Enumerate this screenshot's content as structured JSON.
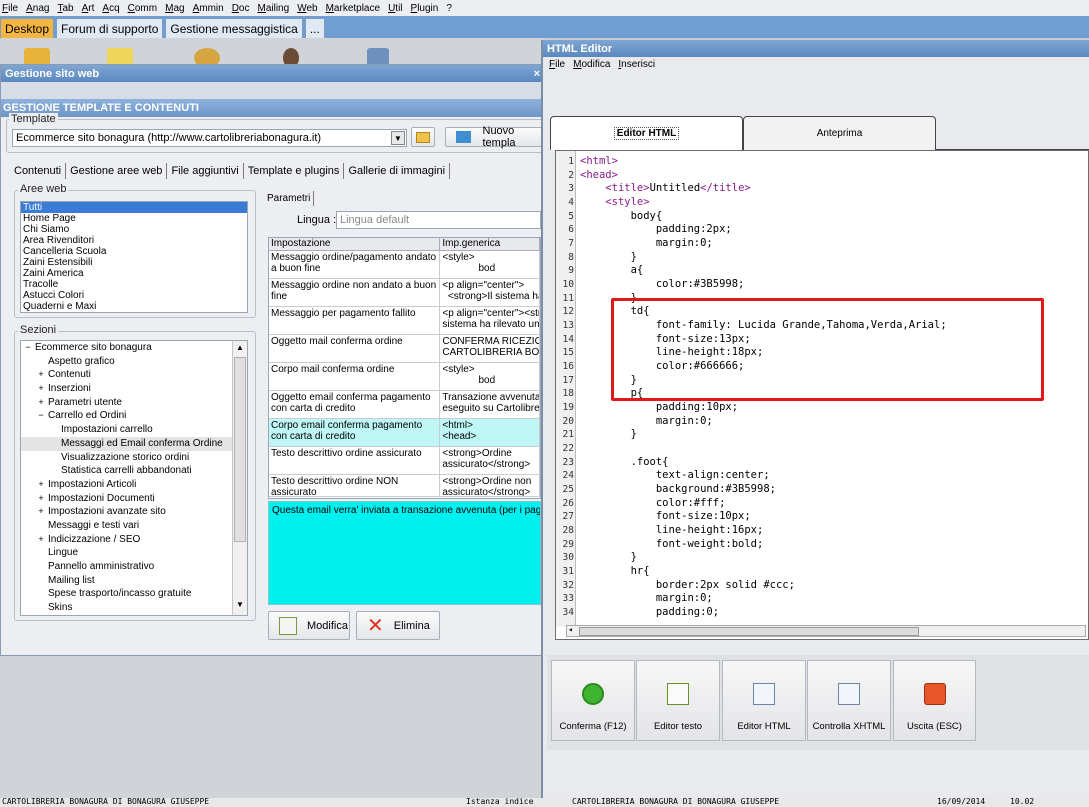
{
  "app_menu": [
    "File",
    "Anag",
    "Tab",
    "Art",
    "Acq",
    "Comm",
    "Mag",
    "Ammin",
    "Doc",
    "Mailing",
    "Web",
    "Marketplace",
    "Util",
    "Plugin",
    "?"
  ],
  "desktop_tabs": [
    "Desktop",
    "Forum di supporto",
    "Gestione messaggistica",
    "..."
  ],
  "win1": {
    "title": "Gestione sito web",
    "close": "×",
    "header": "GESTIONE TEMPLATE E CONTENUTI",
    "template_label": "Template",
    "template_value": "Ecommerce sito bonagura (http://www.cartolibreriabonagura.it)",
    "new_template_label": "Nuovo templa",
    "tabs": [
      "Contenuti",
      "Gestione aree web",
      "File aggiuntivi",
      "Template e plugins",
      "Gallerie di immagini"
    ],
    "aree_label": "Aree web",
    "aree": [
      "Tutti",
      "Home Page",
      "Chi Siamo",
      "Area Rivenditori",
      "Cancelleria Scuola",
      "Zaini Estensibili",
      "Zaini America",
      "Tracolle",
      "Astucci Colori",
      "Quaderni e Maxi"
    ],
    "sezioni_label": "Sezioni",
    "sezioni": [
      {
        "label": "Ecommerce sito bonagura",
        "indent": 0,
        "pm": "−"
      },
      {
        "label": "Aspetto grafico",
        "indent": 1,
        "pm": ""
      },
      {
        "label": "Contenuti",
        "indent": 1,
        "pm": "+"
      },
      {
        "label": "Inserzioni",
        "indent": 1,
        "pm": "+"
      },
      {
        "label": "Parametri utente",
        "indent": 1,
        "pm": "+"
      },
      {
        "label": "Carrello ed Ordini",
        "indent": 1,
        "pm": "−"
      },
      {
        "label": "Impostazioni carrello",
        "indent": 2,
        "pm": ""
      },
      {
        "label": "Messaggi ed Email conferma Ordine",
        "indent": 2,
        "pm": ""
      },
      {
        "label": "Visualizzazione storico ordini",
        "indent": 2,
        "pm": ""
      },
      {
        "label": "Statistica carrelli abbandonati",
        "indent": 2,
        "pm": ""
      },
      {
        "label": "Impostazioni Articoli",
        "indent": 1,
        "pm": "+"
      },
      {
        "label": "Impostazioni Documenti",
        "indent": 1,
        "pm": "+"
      },
      {
        "label": "Impostazioni avanzate sito",
        "indent": 1,
        "pm": "+"
      },
      {
        "label": "Messaggi e testi vari",
        "indent": 1,
        "pm": ""
      },
      {
        "label": "Indicizzazione / SEO",
        "indent": 1,
        "pm": "+"
      },
      {
        "label": "Lingue",
        "indent": 1,
        "pm": ""
      },
      {
        "label": "Pannello amministrativo",
        "indent": 1,
        "pm": ""
      },
      {
        "label": "Mailing list",
        "indent": 1,
        "pm": ""
      },
      {
        "label": "Spese trasporto/incasso gratuite",
        "indent": 1,
        "pm": ""
      },
      {
        "label": "Skins",
        "indent": 1,
        "pm": ""
      }
    ],
    "parametri_tab": "Parametri",
    "lingua_label": "Lingua :",
    "lingua_value": "Lingua default",
    "grid_headers": [
      "Impostazione",
      "Imp.generica"
    ],
    "grid_rows": [
      {
        "a": "Messaggio ordine/pagamento andato a buon fine",
        "b": "<style>\n             bod",
        "h": 28
      },
      {
        "a": "Messaggio ordine non andato a buon fine",
        "b": "<p align=\"center\">\n  <strong>Il sistema ha",
        "h": 28
      },
      {
        "a": "Messaggio per pagamento fallito",
        "b": "<p align=\"center\"><str\nsistema ha rilevato un p",
        "h": 28
      },
      {
        "a": "Oggetto mail conferma ordine",
        "b": "CONFERMA RICEZIONE\nCARTOLIBRERIA BONAG",
        "h": 28
      },
      {
        "a": "Corpo mail conferma ordine",
        "b": "<style>\n             bod",
        "h": 28
      },
      {
        "a": "Oggetto email conferma pagamento con carta di credito",
        "b": "Transazione avvenuta p\neseguito su Cartolibreria",
        "h": 28
      },
      {
        "a": "Corpo email conferma pagamento con carta di credito",
        "b": "<html>\n<head>",
        "h": 28,
        "cyan": true
      },
      {
        "a": "Testo descrittivo ordine assicurato",
        "b": "<strong>Ordine\nassicurato</strong>",
        "h": 28
      },
      {
        "a": "Testo descrittivo ordine NON assicurato",
        "b": "<strong>Ordine non\nassicurato</strong>",
        "h": 22
      }
    ],
    "description": "Questa email verra' inviata a transazione avvenuta (per i pagamen",
    "modifica_label": "Modifica",
    "elimina_label": "Elimina"
  },
  "editor": {
    "title": "HTML Editor",
    "menu": [
      "File",
      "Modifica",
      "Inserisci"
    ],
    "tab_html": "Editor HTML",
    "tab_preview": "Anteprima",
    "lines": [
      "<html>",
      "<head>",
      "    <title>Untitled</title>",
      "    <style>",
      "        body{",
      "            padding:2px;",
      "            margin:0;",
      "        }",
      "        a{",
      "            color:#3B5998;",
      "        }",
      "        td{",
      "            font-family: Lucida Grande,Tahoma,Verda,Arial;",
      "            font-size:13px;",
      "            line-height:18px;",
      "            color:#666666;",
      "        }",
      "        p{",
      "            padding:10px;",
      "            margin:0;",
      "        }",
      "",
      "        .foot{",
      "            text-align:center;",
      "            background:#3B5998;",
      "            color:#fff;",
      "            font-size:10px;",
      "            line-height:16px;",
      "            font-weight:bold;",
      "        }",
      "        hr{",
      "            border:2px solid #ccc;",
      "            margin:0;",
      "            padding:0;"
    ],
    "toolbar": [
      "Conferma (F12)",
      "Editor testo",
      "Editor HTML",
      "Controlla XHTML",
      "Uscita (ESC)"
    ]
  },
  "status": {
    "left": "CARTOLIBRERIA BONAGURA DI BONAGURA GIUSEPPE",
    "mid_label": "Istanza indice",
    "mid": "CARTOLIBRERIA BONAGURA DI BONAGURA GIUSEPPE",
    "date": "16/09/2014",
    "time": "10.02"
  }
}
